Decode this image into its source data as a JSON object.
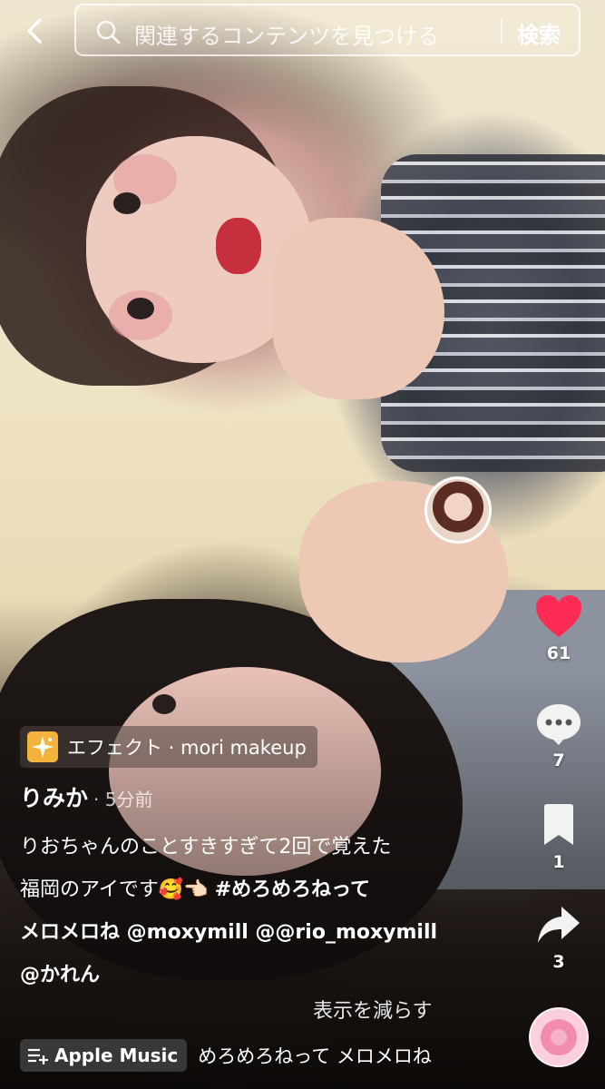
{
  "search": {
    "placeholder": "関連するコンテンツを見つける",
    "button_label": "検索"
  },
  "rail": {
    "likes": "61",
    "comments": "7",
    "bookmarks": "1",
    "shares": "3"
  },
  "effect": {
    "label": "エフェクト · mori makeup"
  },
  "post": {
    "username": "りみか",
    "time_ago": "· 5分前",
    "caption_line1": "りおちゃんのことすきすぎて2回で覚えた",
    "caption_line2_text": "福岡のアイです🥰👈🏻 ",
    "hashtag": "#めろめろねって",
    "caption_line3": "メロメロね @moxymill @@rio_moxymill",
    "caption_line4": "@かれん",
    "see_less": "表示を減らす"
  },
  "music": {
    "service": "Apple Music",
    "song": "めろめろねって メロメロね"
  },
  "colors": {
    "like_red": "#fe2c55",
    "effect_yellow": "#f3b43d"
  }
}
